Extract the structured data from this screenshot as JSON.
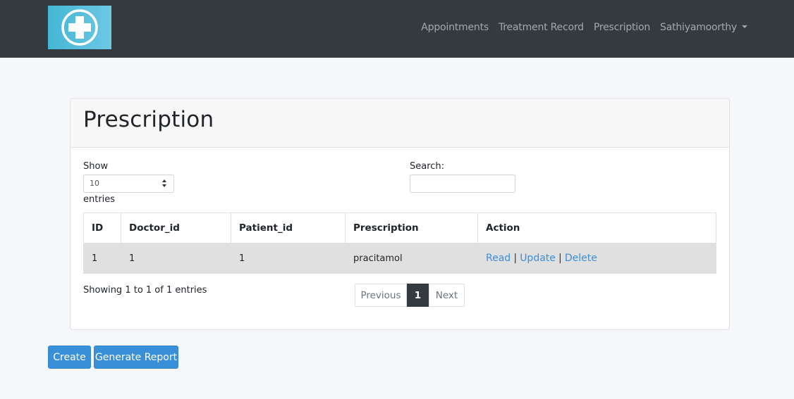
{
  "navbar": {
    "logo_icon": "medical-cross-icon",
    "links": [
      "Appointments",
      "Treatment Record",
      "Prescription"
    ],
    "user": "Sathiyamoorthy",
    "user_dropdown_icon": "caret-down-icon"
  },
  "card": {
    "title": "Prescription"
  },
  "length": {
    "show_label": "Show",
    "value": "10",
    "entries_label": "entries"
  },
  "search": {
    "label": "Search:",
    "value": ""
  },
  "table": {
    "columns": [
      "ID",
      "Doctor_id",
      "Patient_id",
      "Prescription",
      "Action"
    ],
    "rows": [
      {
        "id": "1",
        "doctor_id": "1",
        "patient_id": "1",
        "prescription": "pracitamol",
        "actions": [
          "Read",
          "Update",
          "Delete"
        ],
        "separator": "|"
      }
    ]
  },
  "info": "Showing 1 to 1 of 1 entries",
  "pagination": {
    "previous": "Previous",
    "current": "1",
    "next": "Next"
  },
  "buttons": {
    "create": "Create",
    "report": "Generate Report"
  },
  "colors": {
    "navbar": "#343a40",
    "accent": "#3a8fd9",
    "link": "#3c8edb",
    "row_highlight": "#e0e0e0"
  }
}
